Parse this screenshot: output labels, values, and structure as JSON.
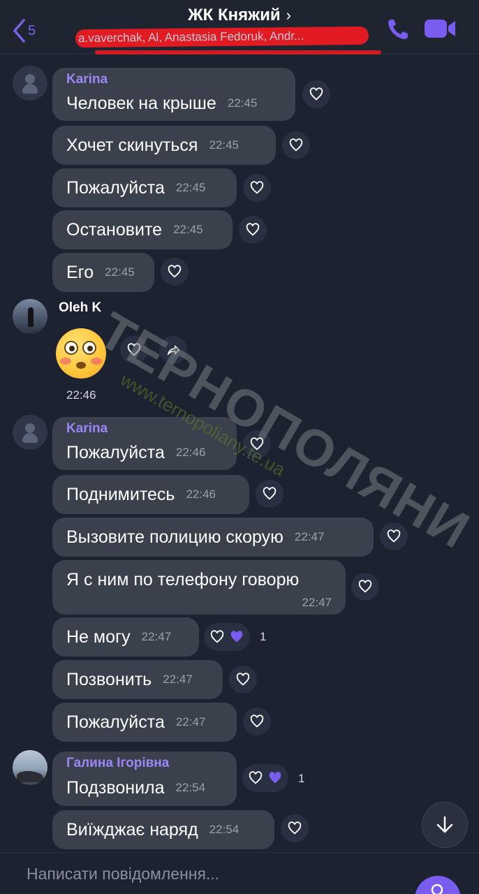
{
  "header": {
    "back_count": "5",
    "title": "ЖК Княжий",
    "title_chevron": "›",
    "participants": "a.vaverchak, Al, Anastasia Fedoruk, Andr..."
  },
  "messages": [
    {
      "sender": "Karina",
      "text": "Человек на крыше",
      "time": "22:45"
    },
    {
      "text": "Хочет скинуться",
      "time": "22:45"
    },
    {
      "text": "Пожалуйста",
      "time": "22:45"
    },
    {
      "text": "Остановите",
      "time": "22:45"
    },
    {
      "text": "Его",
      "time": "22:45"
    },
    {
      "sender": "Oleh K",
      "emoji": "flushed-face",
      "time": "22:46"
    },
    {
      "sender": "Karina",
      "text": "Пожалуйста",
      "time": "22:46"
    },
    {
      "text": "Поднимитесь",
      "time": "22:46"
    },
    {
      "text": "Вызовите полицию скорую",
      "time": "22:47"
    },
    {
      "text": "Я с ним по телефону говорю",
      "time": "22:47"
    },
    {
      "text": "Не могу",
      "time": "22:47",
      "reaction_count": "1"
    },
    {
      "text": "Позвонить",
      "time": "22:47"
    },
    {
      "text": "Пожалуйста",
      "time": "22:47"
    },
    {
      "sender": "Галина Ігорівна",
      "text": "Подзвонила",
      "time": "22:54",
      "reaction_count": "1"
    },
    {
      "text": "Виїжджає наряд",
      "time": "22:54"
    }
  ],
  "watermark": {
    "brand": "ТЕРНОПОЛЯНИ",
    "site": "www.ternopoliany.te.ua"
  },
  "composer": {
    "placeholder": "Написати повідомлення..."
  },
  "colors": {
    "background": "#1c2230",
    "bubble": "#3b404d",
    "accent": "#7a5cf0",
    "sender_name": "#9d86f5"
  },
  "icons": [
    "back-chevron-icon",
    "phone-icon",
    "video-camera-icon",
    "heart-icon",
    "heart-filled-icon",
    "share-icon",
    "arrow-down-icon",
    "send-icon"
  ]
}
